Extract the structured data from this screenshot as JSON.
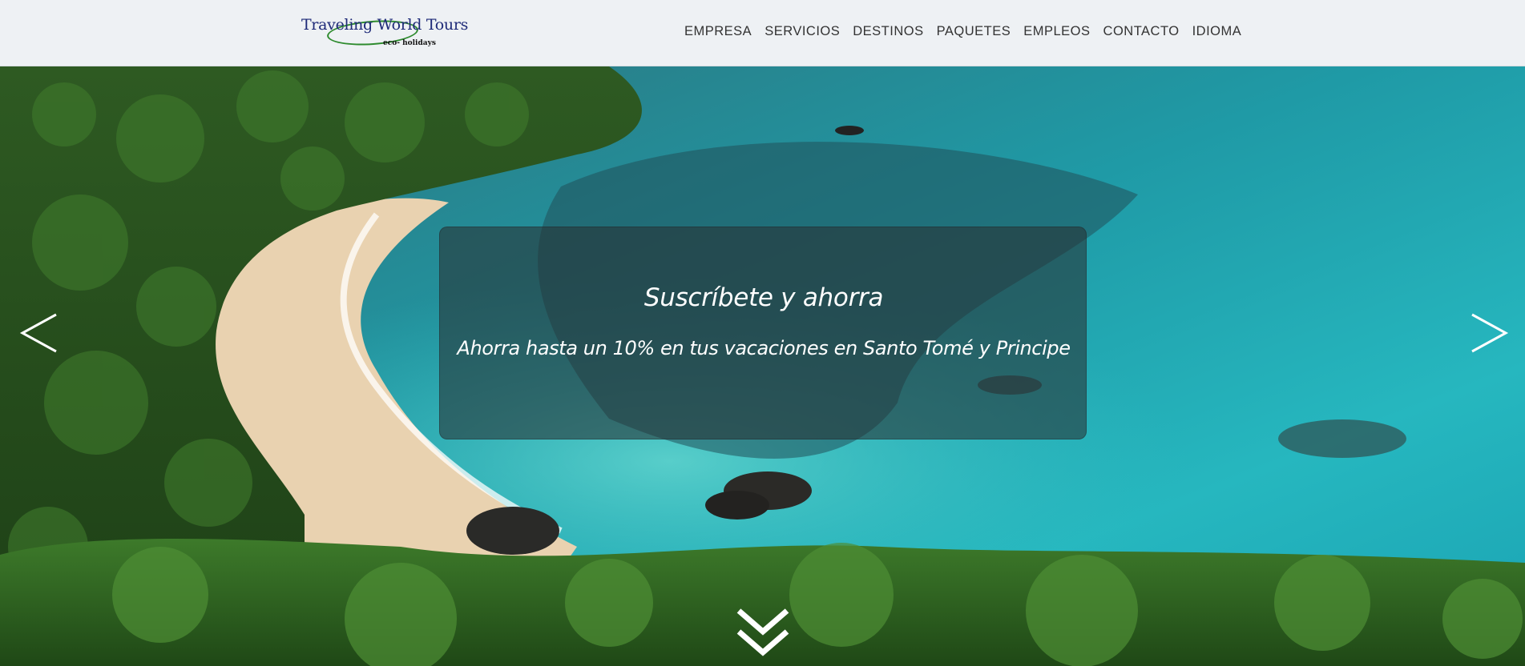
{
  "brand": {
    "name": "Traveling World Tours",
    "tagline": "eco- holidays",
    "colors": {
      "title": "#1e2a78",
      "ellipse": "#2e8b2e"
    }
  },
  "nav": {
    "items": [
      {
        "label": "EMPRESA"
      },
      {
        "label": "SERVICIOS"
      },
      {
        "label": "DESTINOS"
      },
      {
        "label": "PAQUETES"
      },
      {
        "label": "EMPLEOS"
      },
      {
        "label": "CONTACTO"
      },
      {
        "label": "IDIOMA"
      }
    ]
  },
  "hero": {
    "image": "tropical-beach-aerial",
    "caption": {
      "title": "Suscríbete y ahorra",
      "text": "Ahorra hasta un 10% en tus vacaciones en Santo Tomé y Principe"
    },
    "prev_icon": "chevron-left-icon",
    "next_icon": "chevron-right-icon",
    "scroll_icon": "double-chevron-down-icon"
  }
}
